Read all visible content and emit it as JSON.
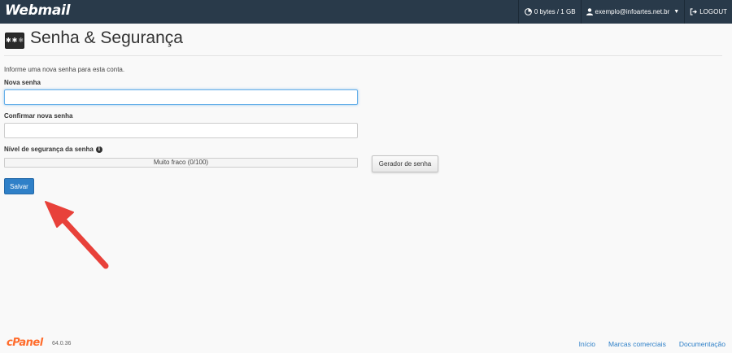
{
  "app": {
    "brand": "Webmail"
  },
  "topnav": {
    "disk_usage": "0 bytes / 1 GB",
    "user_email": "exemplo@infoartes.net.br",
    "logout_label": "LOGOUT"
  },
  "page": {
    "title": "Senha & Segurança",
    "instructions": "Informe uma nova senha para esta conta."
  },
  "form": {
    "new_password_label": "Nova senha",
    "new_password_value": "",
    "confirm_password_label": "Confirmar nova senha",
    "confirm_password_value": "",
    "strength_label": "Nível de segurança da senha",
    "strength_text": "Muito fraco (0/100)",
    "strength_fraction": 0,
    "generator_label": "Gerador de senha",
    "save_label": "Salvar"
  },
  "footer": {
    "logo": "cPanel",
    "version": "64.0.36",
    "links": [
      "Início",
      "Marcas comerciais",
      "Documentação"
    ]
  },
  "colors": {
    "topbar": "#293a4a",
    "primary": "#2f80c8",
    "arrow": "#e8413a",
    "cpanel_orange": "#ff6c2c"
  },
  "icons": [
    "disk-usage-icon",
    "user-icon",
    "chevron-down-icon",
    "logout-icon",
    "password-page-icon",
    "info-icon",
    "red-arrow-annotation"
  ]
}
